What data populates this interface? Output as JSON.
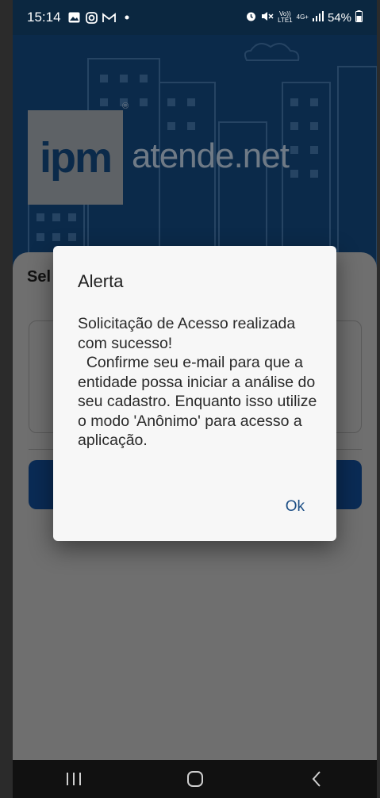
{
  "status_bar": {
    "time": "15:14",
    "left_icons": [
      "image-icon",
      "instagram-icon",
      "gmail-icon",
      "dot-icon"
    ],
    "volte_top": "Vo))",
    "volte_bottom": "LTE1",
    "network": "4G+",
    "battery": "54%"
  },
  "app": {
    "logo_ipm": "ipm",
    "logo_reg": "®",
    "logo_text_bold": "atende",
    "logo_text_thin": ".net",
    "section_title": "Sel"
  },
  "dialog": {
    "title": "Alerta",
    "message": "Solicitação de Acesso realizada com sucesso!\n  Confirme seu e-mail para que a entidade possa iniciar a análise do seu cadastro. Enquanto isso utilize o modo 'Anônimo' para acesso a aplicação.",
    "ok_label": "Ok"
  },
  "colors": {
    "header_bg": "#0b2a4a",
    "dialog_bg": "#f7f7f7",
    "ok_text": "#1d4f86",
    "primary_button": "#0a2b55"
  }
}
